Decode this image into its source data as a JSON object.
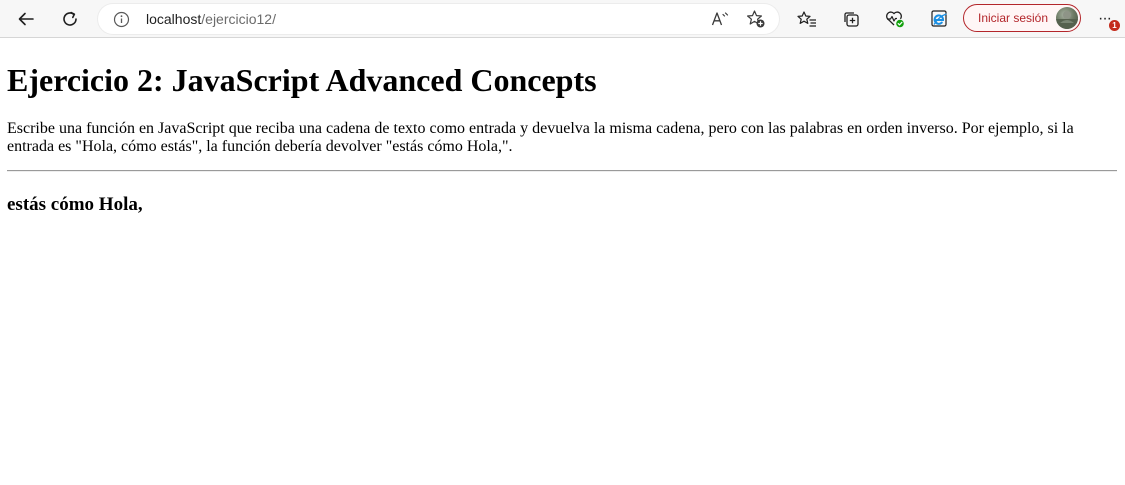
{
  "browser": {
    "address": {
      "host": "localhost",
      "path": "/ejercicio12/"
    },
    "signin_label": "Iniciar sesión",
    "notification_count": "1",
    "icons": {
      "back": "back-arrow-icon",
      "refresh": "refresh-icon",
      "info": "info-icon",
      "read_aloud": "read-aloud-icon",
      "add_favorite": "add-favorite-icon",
      "favorites": "favorites-icon",
      "collections": "collections-icon",
      "browser_essentials": "heart-pulse-icon",
      "ie_mode": "internet-explorer-icon",
      "menu": "more-options-icon"
    },
    "colors": {
      "signin_accent": "#b3262b",
      "badge": "#c42b1c"
    }
  },
  "page": {
    "title": "Ejercicio 2: JavaScript Advanced Concepts",
    "description": "Escribe una función en JavaScript que reciba una cadena de texto como entrada y devuelva la misma cadena, pero con las palabras en orden inverso. Por ejemplo, si la entrada es \"Hola, cómo estás\", la función debería devolver \"estás cómo Hola,\".",
    "result": "estás cómo Hola,"
  }
}
